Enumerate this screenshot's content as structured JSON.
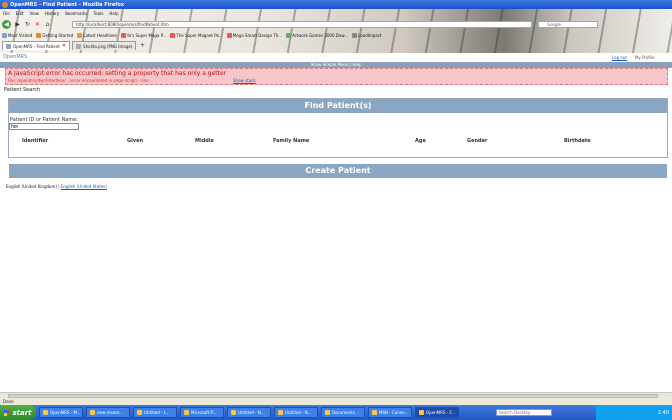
{
  "browser": {
    "window_title": "OpenMRS - Find Patient - Mozilla Firefox",
    "menu": [
      "File",
      "Edit",
      "View",
      "History",
      "Bookmarks",
      "Tools",
      "Help"
    ],
    "url": "http://localhost:8080/openmrs/findPatient.htm",
    "search_engine": "Google",
    "bookmarks": [
      "Most Visited",
      "Getting Started",
      "Latest Headlines",
      "Yo's Super Mega P...",
      "The Super Magnet Po...",
      "Mega Smart Design Th...",
      "Artwork Games 3000 Dow...",
      "LoadImpact"
    ],
    "tabs": [
      {
        "title": "OpenMRS - Find Patient",
        "active": true
      },
      {
        "title": "Sholita.png (PNG Image)",
        "active": false
      }
    ],
    "status": "Done"
  },
  "page": {
    "logo_text": "OpenMRS",
    "logout": "Log out",
    "my_profile": "My Profile",
    "dark_strip_text": "Show Simple Menu | Help",
    "error": {
      "title": "A JavaScript error has occurred: setting a property that has only a getter",
      "message": "File: /openmrs/dwr/interface/...(error encountered in page script) - line ...",
      "show_stack": "Show stack"
    },
    "patient_search_label": "Patient Search",
    "find_header": "Find Patient(s)",
    "search_hint": "Patient ID or Patient Name:",
    "search_value": "hor",
    "columns": [
      "Identifier",
      "Given",
      "Middle",
      "Family Name",
      "Age",
      "Gender",
      "Birthdate"
    ],
    "create_header": "Create Patient",
    "languages": {
      "current": "English (United Kingdom)",
      "sep": "|",
      "links": [
        "English (United States)"
      ]
    }
  },
  "taskbar": {
    "start": "start",
    "buttons": [
      "OpenMRS - M...",
      "new-resear...",
      "Untitled - L...",
      "Microsoft P...",
      "Untitled - N...",
      "Untitled - N...",
      "Documents...",
      "MSN - Conne...",
      "OpenMRS - F..."
    ],
    "desktop_search_placeholder": "Search Desktop",
    "clock": "2:40"
  },
  "colors": {
    "accent": "#8ba6c3",
    "error_bg": "#f6c6cb",
    "error_text": "#b11"
  }
}
